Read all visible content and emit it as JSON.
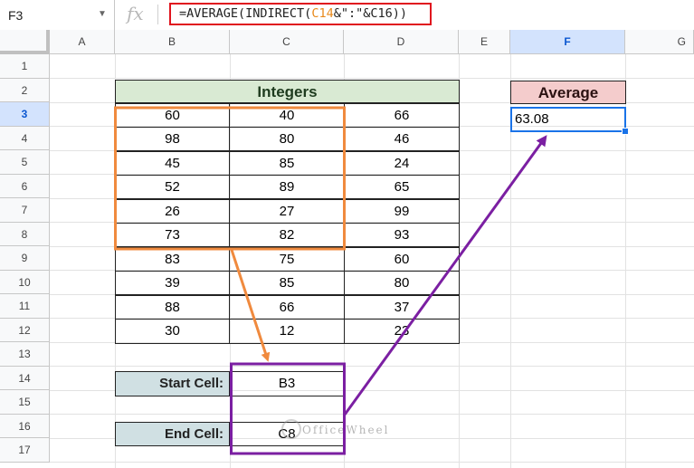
{
  "formula_bar": {
    "cell_ref": "F3",
    "fx_label": "fx",
    "formula_prefix": "=AVERAGE(INDIRECT(",
    "formula_ref1": "C14",
    "formula_suffix": "&\":\"&C16))"
  },
  "columns": [
    "A",
    "B",
    "C",
    "D",
    "E",
    "F",
    "G"
  ],
  "rows": [
    "1",
    "2",
    "3",
    "4",
    "5",
    "6",
    "7",
    "8",
    "9",
    "10",
    "11",
    "12",
    "13",
    "14",
    "15",
    "16",
    "17"
  ],
  "table": {
    "header": "Integers",
    "rows": [
      [
        "60",
        "40",
        "66"
      ],
      [
        "98",
        "80",
        "46"
      ],
      [
        "45",
        "85",
        "24"
      ],
      [
        "52",
        "89",
        "65"
      ],
      [
        "26",
        "27",
        "99"
      ],
      [
        "73",
        "82",
        "93"
      ],
      [
        "83",
        "75",
        "60"
      ],
      [
        "39",
        "85",
        "80"
      ],
      [
        "88",
        "66",
        "37"
      ],
      [
        "30",
        "12",
        "23"
      ]
    ]
  },
  "average": {
    "header": "Average",
    "value": "63.08"
  },
  "start_cell": {
    "label": "Start Cell:",
    "value": "B3"
  },
  "end_cell": {
    "label": "End Cell:",
    "value": "C8"
  },
  "watermark": "OfficeWheel",
  "colors": {
    "highlight_orange": "#f08a3e",
    "highlight_purple": "#7b1fa2",
    "formula_border": "#e0141e",
    "selection_blue": "#1a73e8"
  }
}
